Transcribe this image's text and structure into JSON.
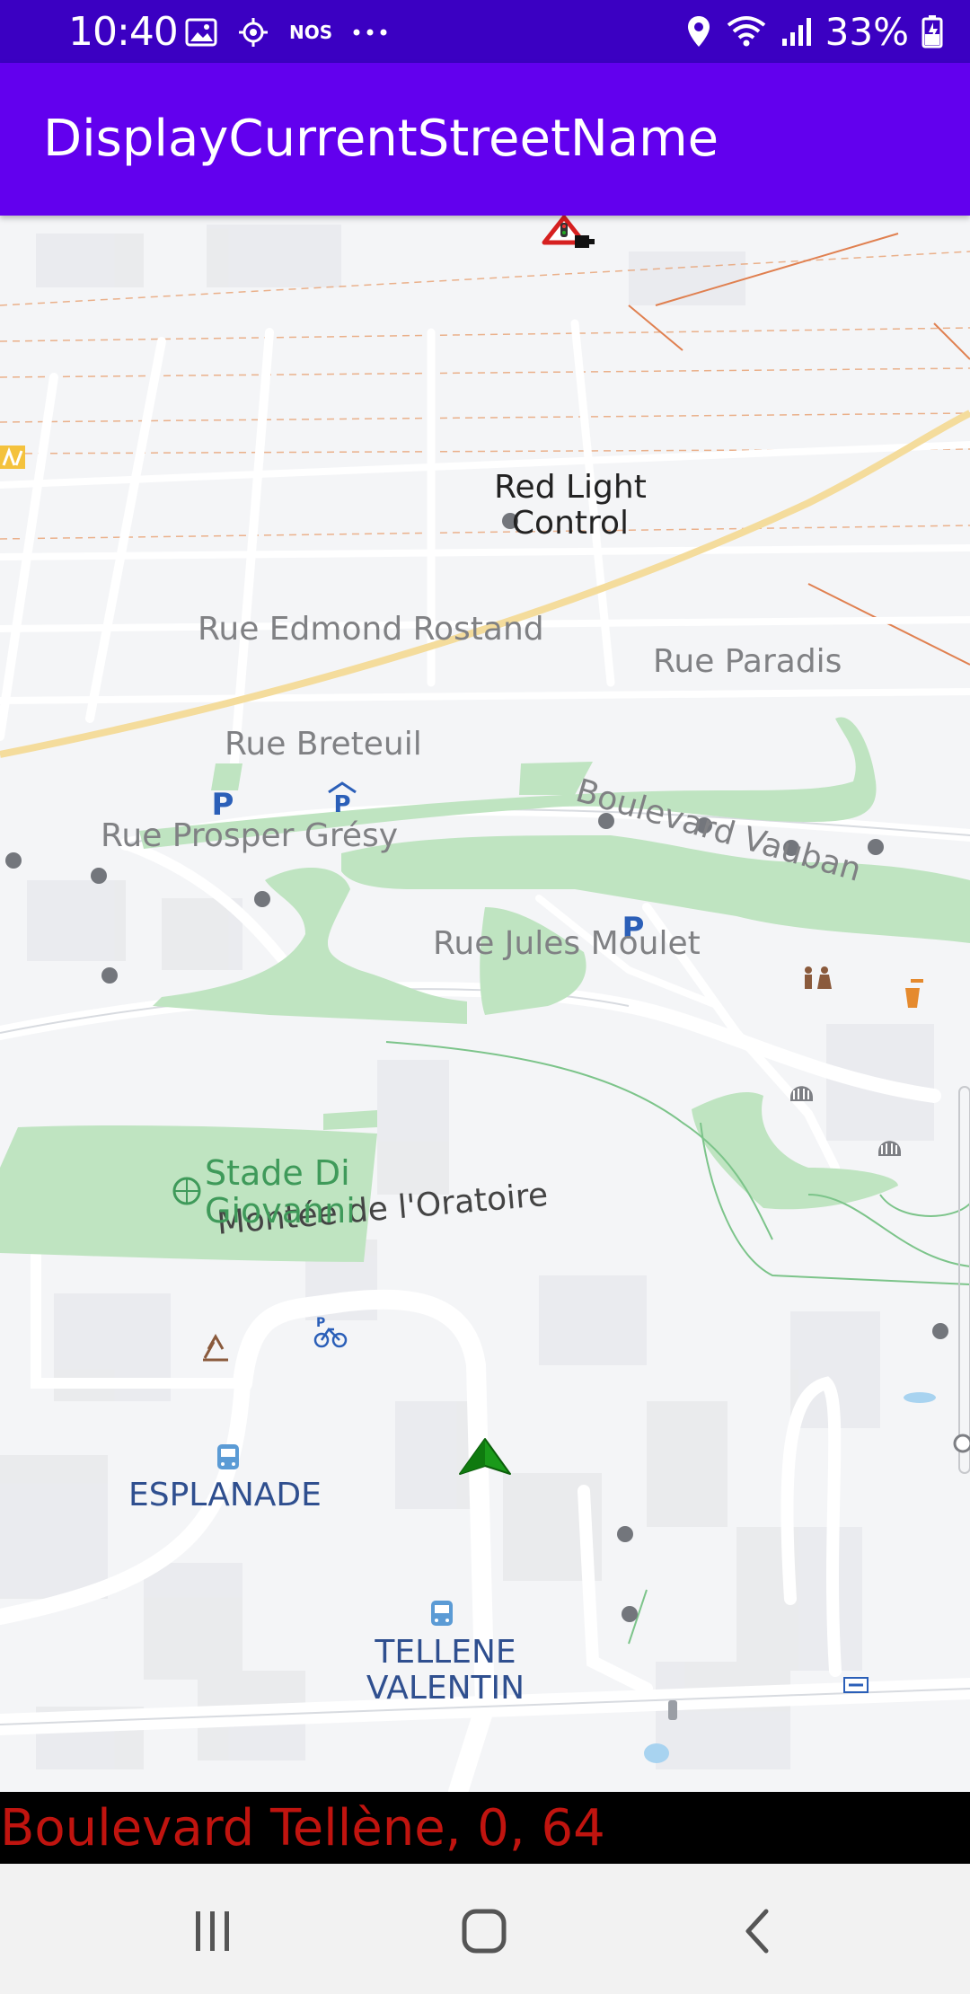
{
  "status_bar": {
    "time": "10:40",
    "left_icons": [
      "image-icon",
      "location-target-icon",
      "nos-label",
      "more-dots-icon"
    ],
    "nos_label": "NOS",
    "right_icons": [
      "location-pin-icon",
      "wifi-icon",
      "signal-icon",
      "battery-icon"
    ],
    "battery_percent": "33%"
  },
  "app_bar": {
    "title": "DisplayCurrentStreetName"
  },
  "map": {
    "streets": {
      "rue_edmond_rostand": "Rue Edmond Rostand",
      "rue_paradis": "Rue Paradis",
      "rue_breteuil": "Rue Breteuil",
      "boulevard_vauban": "Boulevard Vauban",
      "rue_prosper_gresy": "Rue Prosper Grésy",
      "rue_jules_moulet": "Rue Jules Moulet",
      "montee_oratoire": "Montée de l'Oratoire"
    },
    "pois": {
      "red_light_line1": "Red Light",
      "red_light_line2": "Control",
      "stade_line1": "Stade Di",
      "stade_line2": "Giovanni",
      "esplanade": "ESPLANADE",
      "tellene_line1": "TELLENE",
      "tellene_line2": "VALENTIN",
      "parking": "P"
    },
    "colors": {
      "park": "#bfe4c1",
      "street_text": "#7a7a7a",
      "poi_text": "#2f4f8f",
      "park_text": "#3f9a5a",
      "parking": "#2b5fb8",
      "arrow": "#1a9a1a"
    }
  },
  "street_banner": {
    "text": "Boulevard Tellène, 0, 64"
  },
  "nav_bar": {
    "icons": [
      "recent-apps-icon",
      "home-icon",
      "back-icon"
    ]
  }
}
